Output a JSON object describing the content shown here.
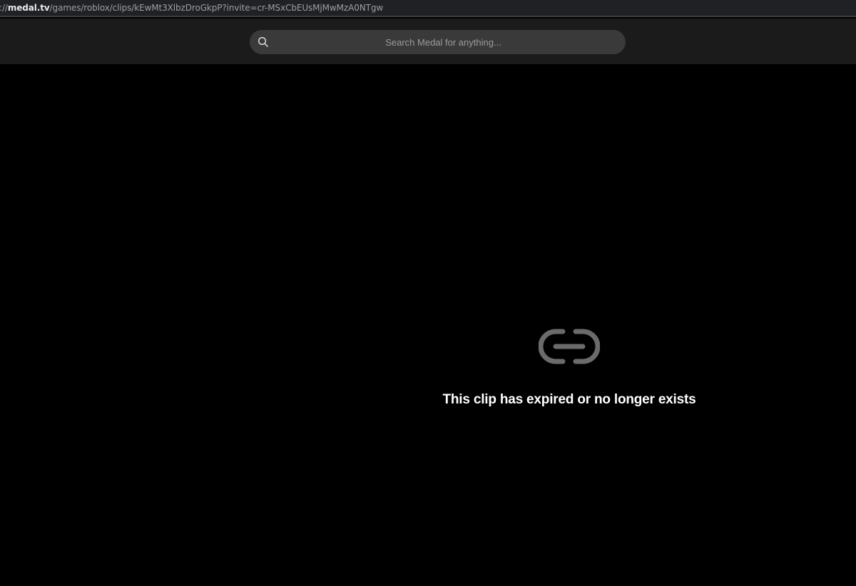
{
  "browser": {
    "url_prefix": "://",
    "url_host": "medal.tv",
    "url_path": "/games/roblox/clips/kEwMt3XlbzDroGkpP?invite=cr-MSxCbEUsMjMwMzA0NTgw"
  },
  "header": {
    "search": {
      "placeholder": "Search Medal for anything...",
      "icon": "search-icon"
    }
  },
  "main": {
    "icon": "link-icon",
    "message": "This clip has expired or no longer exists"
  },
  "colors": {
    "background": "#000000",
    "header": "#1b1b1b",
    "search_field": "#3a3a3a",
    "icon_gray": "#6b6b6b",
    "text": "#ffffff"
  }
}
